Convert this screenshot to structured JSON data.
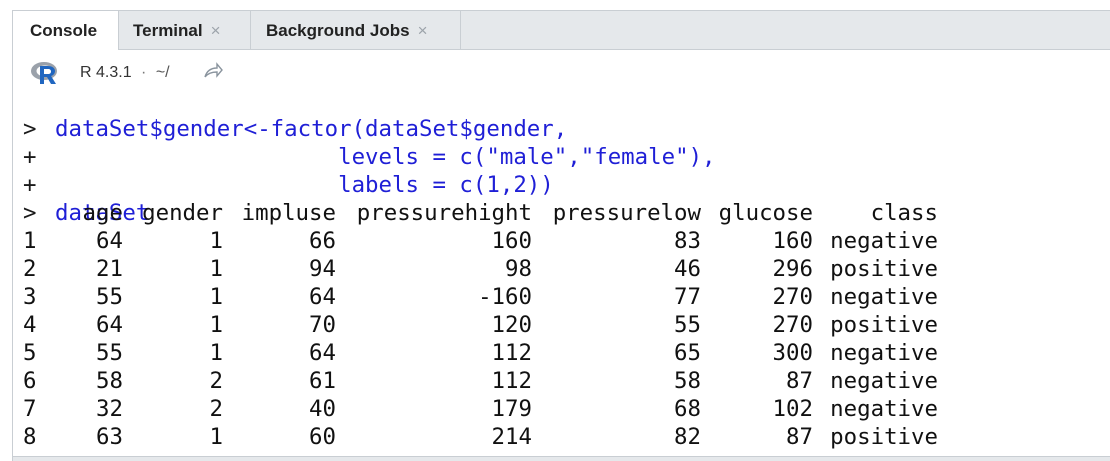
{
  "tabs": [
    {
      "label": "Console",
      "closable": false,
      "active": true
    },
    {
      "label": "Terminal",
      "closable": true,
      "active": false
    },
    {
      "label": "Background Jobs",
      "closable": true,
      "active": false
    }
  ],
  "close_glyph": "×",
  "toolbar": {
    "r_version": "R 4.3.1",
    "separator": "·",
    "path": "~/",
    "logo_icon": "r-logo-icon",
    "goto_dir_icon": "arrow-icon"
  },
  "colors": {
    "code": "#1f1fd6",
    "output": "#111111",
    "tabbar_bg": "#e5e8eb"
  },
  "console": {
    "commands": [
      {
        "prompt": ">",
        "text": "dataSet$gender<-factor(dataSet$gender,"
      },
      {
        "prompt": "+",
        "text": "                     levels = c(\"male\",\"female\"),"
      },
      {
        "prompt": "+",
        "text": "                     labels = c(1,2))"
      },
      {
        "prompt": ">",
        "text": "dataSet"
      }
    ],
    "table": {
      "columns": [
        "age",
        "gender",
        "impluse",
        "pressurehight",
        "pressurelow",
        "glucose",
        "class"
      ],
      "rows": [
        {
          "name": "1",
          "values": [
            "64",
            "1",
            "66",
            "160",
            "83",
            "160",
            "negative"
          ]
        },
        {
          "name": "2",
          "values": [
            "21",
            "1",
            "94",
            "98",
            "46",
            "296",
            "positive"
          ]
        },
        {
          "name": "3",
          "values": [
            "55",
            "1",
            "64",
            "-160",
            "77",
            "270",
            "negative"
          ]
        },
        {
          "name": "4",
          "values": [
            "64",
            "1",
            "70",
            "120",
            "55",
            "270",
            "positive"
          ]
        },
        {
          "name": "5",
          "values": [
            "55",
            "1",
            "64",
            "112",
            "65",
            "300",
            "negative"
          ]
        },
        {
          "name": "6",
          "values": [
            "58",
            "2",
            "61",
            "112",
            "58",
            "87",
            "negative"
          ]
        },
        {
          "name": "7",
          "values": [
            "32",
            "2",
            "40",
            "179",
            "68",
            "102",
            "negative"
          ]
        },
        {
          "name": "8",
          "values": [
            "63",
            "1",
            "60",
            "214",
            "82",
            "87",
            "positive"
          ]
        }
      ]
    }
  }
}
